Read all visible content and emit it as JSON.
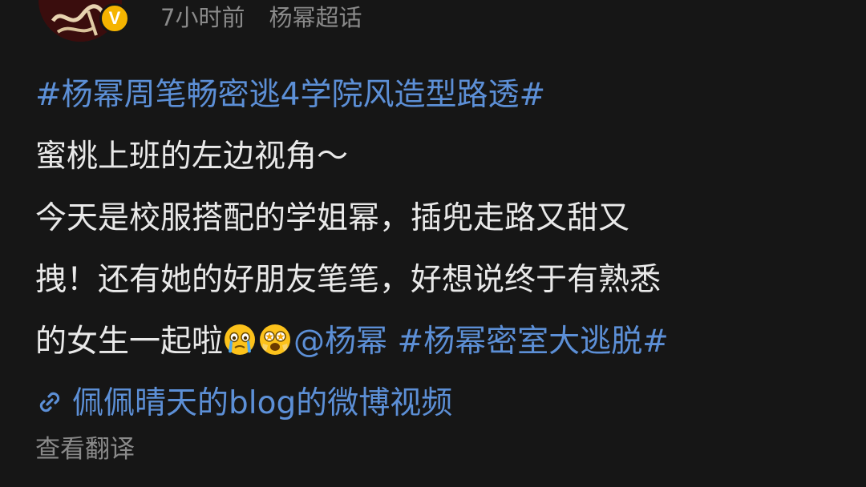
{
  "header": {
    "time": "7小时前",
    "topic": "杨幂超话",
    "verified_badge": "V"
  },
  "post": {
    "hashtag_title": "#杨幂周笔畅密逃4学院风造型路透#",
    "line2": "蜜桃上班的左边视角～",
    "line3": "今天是校服搭配的学姐幂，插兜走路又甜又",
    "line4": "拽！还有她的好朋友笔笔，好想说终于有熟悉",
    "line5_text": "的女生一起啦",
    "emoji1": "crying-face-emoji",
    "emoji2": "star-struck-face-emoji",
    "mention": "@杨幂",
    "hashtag2": "#杨幂密室大逃脱#",
    "link_icon": "link-icon",
    "video_link": "佩佩晴天的blog的微博视频"
  },
  "footer": {
    "translate": "查看翻译"
  },
  "colors": {
    "background": "#161616",
    "text": "#e9e9e9",
    "meta": "#8a8a8a",
    "link": "#5c8fd6",
    "badge": "#f5b400"
  }
}
